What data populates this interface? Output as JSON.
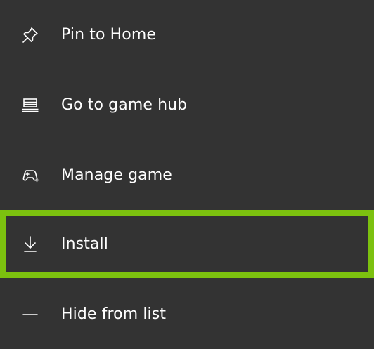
{
  "menu": {
    "items": [
      {
        "label": "Pin to Home",
        "icon": "pin-icon"
      },
      {
        "label": "Go to game hub",
        "icon": "game-hub-icon"
      },
      {
        "label": "Manage game",
        "icon": "controller-icon"
      },
      {
        "label": "Install",
        "icon": "download-icon",
        "selected": true
      },
      {
        "label": "Hide from list",
        "icon": "minus-icon"
      }
    ]
  },
  "colors": {
    "background": "#333333",
    "text": "#ffffff",
    "focus_border": "#7cc10f"
  }
}
